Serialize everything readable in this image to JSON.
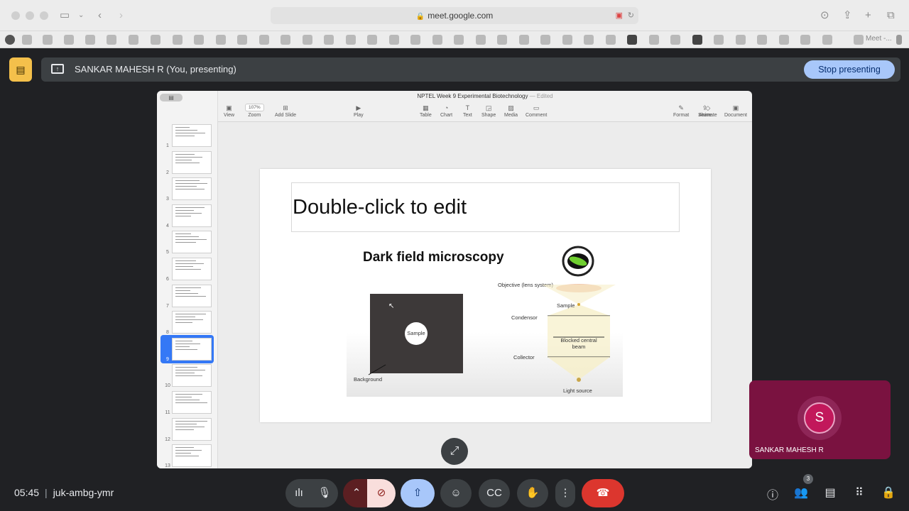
{
  "browser": {
    "url": "meet.google.com",
    "bookmark_tail": "Meet -..."
  },
  "presenting_bar": {
    "presenter_label": "SANKAR MAHESH R (You, presenting)",
    "stop_button": "Stop presenting"
  },
  "keynote": {
    "doc_title": "NPTEL Week 9 Experimental Biotechnology",
    "doc_status": "— Edited",
    "toolbar": {
      "view": "View",
      "zoom_value": "107%",
      "zoom": "Zoom",
      "add_slide": "Add Slide",
      "play": "Play",
      "table": "Table",
      "chart": "Chart",
      "text": "Text",
      "shape": "Shape",
      "media": "Media",
      "comment": "Comment",
      "share": "Share",
      "format": "Format",
      "animate": "Animate",
      "document": "Document"
    },
    "slide_numbers": [
      "1",
      "2",
      "3",
      "4",
      "5",
      "6",
      "7",
      "8",
      "9",
      "10",
      "11",
      "12",
      "13"
    ],
    "selected_slide": 9,
    "slide": {
      "placeholder": "Double-click to edit",
      "image_title": "Dark field microscopy",
      "sample_label": "Sample",
      "background_label": "Background",
      "objective_label": "Objective (lens system)",
      "sample_label_right": "Sample",
      "condenser_label": "Condensor",
      "blocked_beam_line1": "Blocked central",
      "blocked_beam_line2": "beam",
      "collector_label": "Collector",
      "light_source_label": "Light source"
    }
  },
  "participant": {
    "initial": "S",
    "name": "SANKAR MAHESH R"
  },
  "meeting": {
    "time": "05:45",
    "code": "juk-ambg-ymr",
    "participant_count": "3"
  },
  "colors": {
    "accent_blue": "#a8c7fa",
    "end_call_red": "#dc362e",
    "avatar_pink": "#c2185b"
  }
}
